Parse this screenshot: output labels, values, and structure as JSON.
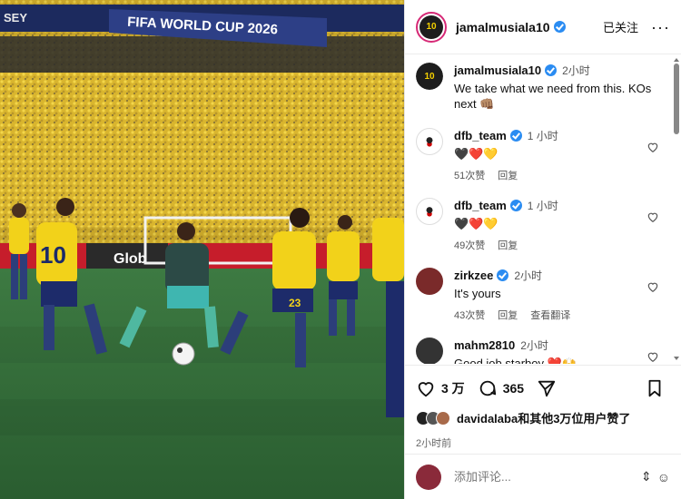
{
  "photo": {
    "banner_left": "SEY",
    "banner_title": "FIFA WORLD CUP 2026",
    "board_text": "Glob",
    "jersey_numbers": [
      "10",
      "23"
    ],
    "description_colors": {
      "pitch": "#2f6a37",
      "crowd": "#e2c23a",
      "away_kit": "#2c4a46",
      "home_kit": "#f2d21a"
    }
  },
  "header": {
    "username": "jamalmusiala10",
    "follow_label": "已关注",
    "more_label": "···"
  },
  "caption": {
    "username": "jamalmusiala10",
    "time": "2小时",
    "text": "We take what we need from this. KOs next 👊🏽"
  },
  "comments": [
    {
      "username": "dfb_team",
      "verified": true,
      "time": "1 小时",
      "text": "🖤❤️💛",
      "likes": "51次赞",
      "reply": "回复",
      "translate": ""
    },
    {
      "username": "dfb_team",
      "verified": true,
      "time": "1 小时",
      "text": "🖤❤️💛",
      "likes": "49次赞",
      "reply": "回复",
      "translate": ""
    },
    {
      "username": "zirkzee",
      "verified": true,
      "time": "2小时",
      "text": "It's yours",
      "likes": "43次赞",
      "reply": "回复",
      "translate": "查看翻译"
    },
    {
      "username": "mahm2810",
      "verified": false,
      "time": "2小时",
      "text": "Good job starboy ❤️🙌"
    }
  ],
  "actions": {
    "like_count": "3 万",
    "comment_count": "365",
    "liked_by": "davidalaba和其他3万位用户赞了",
    "post_time": "2小时前"
  },
  "add_comment": {
    "placeholder": "添加评论..."
  },
  "colors": {
    "verified": "#2a8cf2",
    "ring": "#d62976"
  }
}
